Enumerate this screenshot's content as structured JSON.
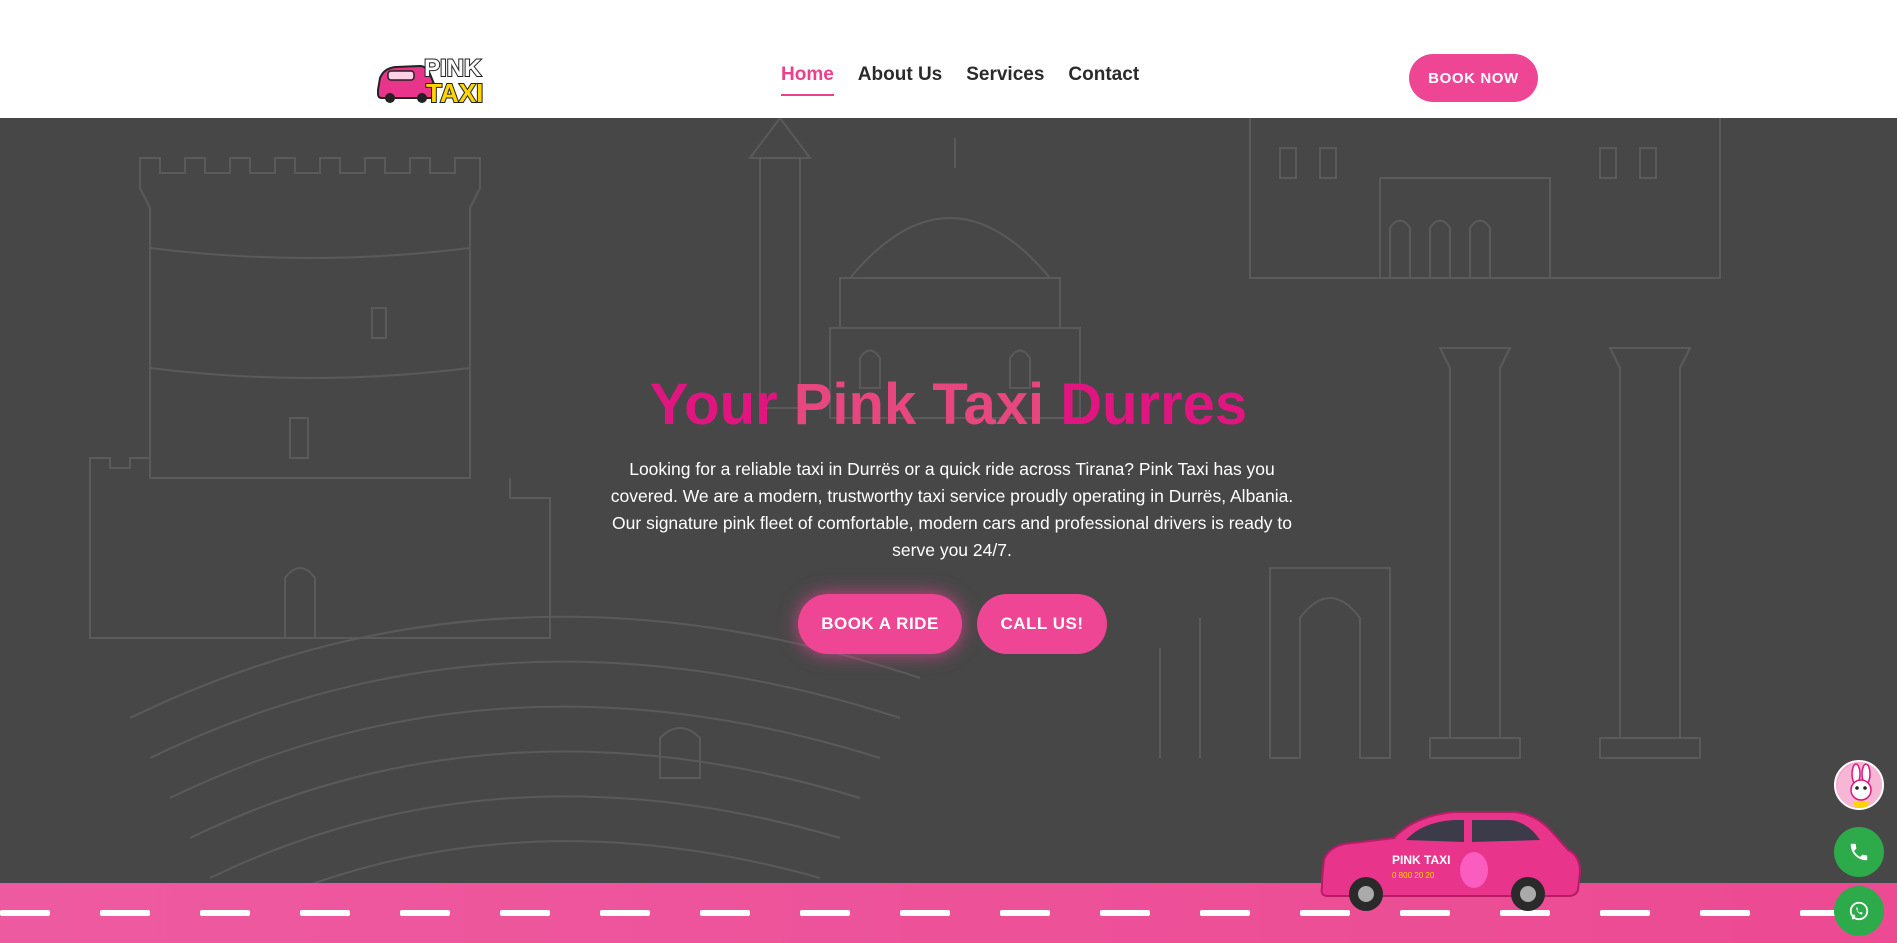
{
  "header": {
    "logo_icon": "pink-taxi-logo",
    "logo_text_top": "PINK",
    "logo_text_bottom": "TAXI",
    "nav": [
      {
        "label": "Home",
        "active": true
      },
      {
        "label": "About Us",
        "active": false
      },
      {
        "label": "Services",
        "active": false
      },
      {
        "label": "Contact",
        "active": false
      }
    ],
    "book_now_label": "BOOK NOW"
  },
  "hero": {
    "title_part1": "Your",
    "title_part2": "Pink Taxi",
    "title_part3": "Durres",
    "description": "Looking for a reliable taxi in Durrës or a quick ride across Tirana? Pink Taxi has you covered. We are a modern, trustworthy taxi service proudly operating in Durrës, Albania. Our signature pink fleet of comfortable, modern cars and professional drivers is ready to serve you 24/7.",
    "book_ride_label": "BOOK A RIDE",
    "call_us_label": "CALL US!",
    "background_icon": "sketch-durres-landmarks"
  },
  "car": {
    "brand_text": "PINK TAXI",
    "phone_text": "0 800 20 20"
  },
  "floating": {
    "mascot_icon": "bunny-mascot-icon",
    "phone_icon": "phone-icon",
    "whatsapp_icon": "whatsapp-icon"
  },
  "colors": {
    "accent": "#ee4595",
    "title_pink": "#e0157f",
    "hero_bg": "#474747",
    "green": "#2daa4a"
  }
}
